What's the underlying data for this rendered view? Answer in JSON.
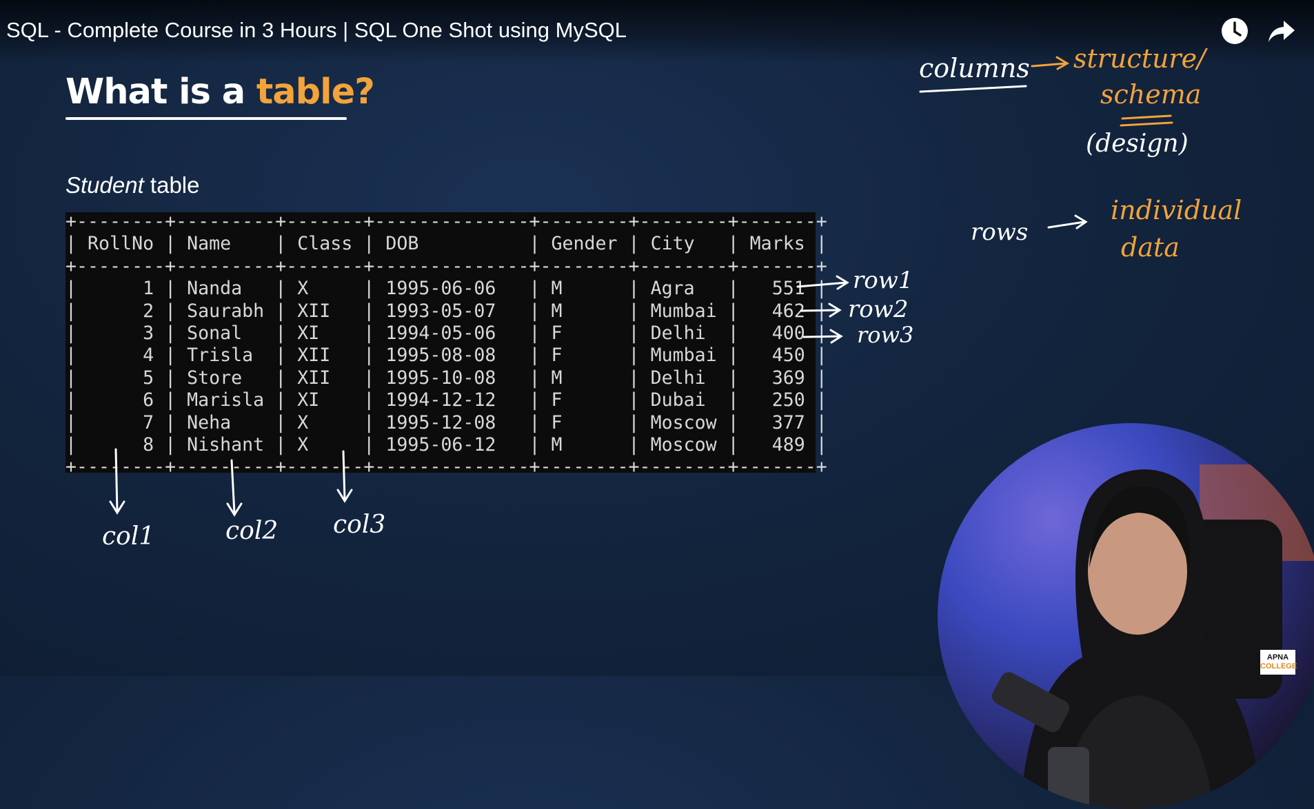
{
  "video": {
    "title": "SQL - Complete Course in 3 Hours | SQL One Shot using MySQL",
    "watch_later_icon": "clock-icon",
    "share_icon": "share-arrow-icon"
  },
  "slide": {
    "title_prefix": "What is a ",
    "title_accent": "table?",
    "accent_color": "#f2a33a",
    "caption_italic": "Student",
    "caption_rest": " table"
  },
  "table": {
    "columns": [
      "RollNo",
      "Name",
      "Class",
      "DOB",
      "Gender",
      "City",
      "Marks"
    ],
    "rows": [
      [
        "1",
        "Nanda",
        "X",
        "1995-06-06",
        "M",
        "Agra",
        "551"
      ],
      [
        "2",
        "Saurabh",
        "XII",
        "1993-05-07",
        "M",
        "Mumbai",
        "462"
      ],
      [
        "3",
        "Sonal",
        "XI",
        "1994-05-06",
        "F",
        "Delhi",
        "400"
      ],
      [
        "4",
        "Trisla",
        "XII",
        "1995-08-08",
        "F",
        "Mumbai",
        "450"
      ],
      [
        "5",
        "Store",
        "XII",
        "1995-10-08",
        "M",
        "Delhi",
        "369"
      ],
      [
        "6",
        "Marisla",
        "XI",
        "1994-12-12",
        "F",
        "Dubai",
        "250"
      ],
      [
        "7",
        "Neha",
        "X",
        "1995-12-08",
        "F",
        "Moscow",
        "377"
      ],
      [
        "8",
        "Nishant",
        "X",
        "1995-06-12",
        "M",
        "Moscow",
        "489"
      ]
    ]
  },
  "annotations": {
    "columns_word": "columns",
    "structure_word": "structure/",
    "schema_word": "schema",
    "design_word": "(design)",
    "rows_word": "rows",
    "individual_word": "individual",
    "data_word": "data",
    "row_labels": [
      "row1",
      "row2",
      "row3"
    ],
    "col_labels": [
      "col1",
      "col2",
      "col3"
    ],
    "ink_white": "#ffffff",
    "ink_orange": "#f2a33a"
  },
  "branding": {
    "logo_line1": "APNA",
    "logo_line2": "COLLEGE"
  }
}
